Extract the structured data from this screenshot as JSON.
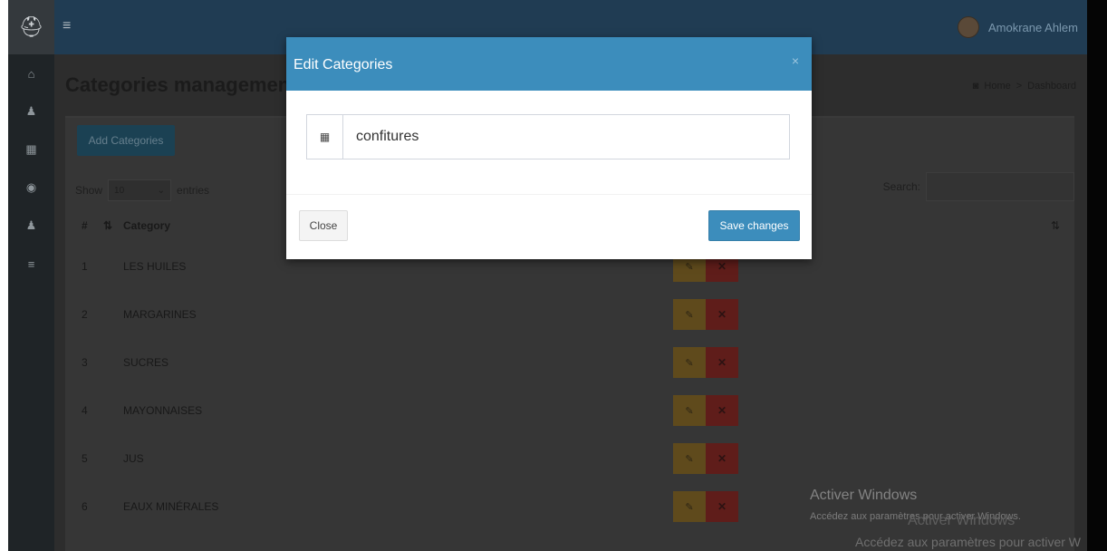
{
  "sidebar": {
    "logo_icon": "ship-helmet-icon",
    "items": [
      {
        "icon": "home-icon",
        "glyph": "⌂"
      },
      {
        "icon": "user-icon",
        "glyph": "♟"
      },
      {
        "icon": "grid-icon",
        "glyph": "▦"
      },
      {
        "icon": "product-icon",
        "glyph": "◉"
      },
      {
        "icon": "user-icon",
        "glyph": "♟"
      },
      {
        "icon": "list-icon",
        "glyph": "≡"
      }
    ]
  },
  "topbar": {
    "menu_glyph": "≡",
    "user_name": "Amokrane Ahlem"
  },
  "page": {
    "title": "Categories management",
    "breadcrumb_home": "Home",
    "breadcrumb_sep": ">",
    "breadcrumb_current": "Dashboard"
  },
  "box": {
    "add_button": "Add Categories",
    "show_label": "Show",
    "entries_value": "10",
    "entries_label": "entries",
    "search_label": "Search:"
  },
  "table": {
    "col_num": "#",
    "col_category": "Category",
    "rows": [
      {
        "num": "1",
        "category": "LES HUILES"
      },
      {
        "num": "2",
        "category": "MARGARINES"
      },
      {
        "num": "3",
        "category": "SUCRES"
      },
      {
        "num": "4",
        "category": "MAYONNAISES"
      },
      {
        "num": "5",
        "category": "JUS"
      },
      {
        "num": "6",
        "category": "EAUX MINÉRALES"
      }
    ]
  },
  "modal": {
    "title": "Edit Categories",
    "close_glyph": "×",
    "input_value": "confitures",
    "close_button": "Close",
    "save_button": "Save changes"
  },
  "watermark": {
    "title": "Activer Windows",
    "subtitle": "Accédez aux paramètres pour activer Windows.",
    "title2": "Activer Windows",
    "subtitle2": "Accédez aux paramètres pour activer W"
  },
  "colors": {
    "primary": "#3c8dbc",
    "topbar": "#222d32",
    "danger": "#dd4b39",
    "warning": "#f39c12"
  }
}
